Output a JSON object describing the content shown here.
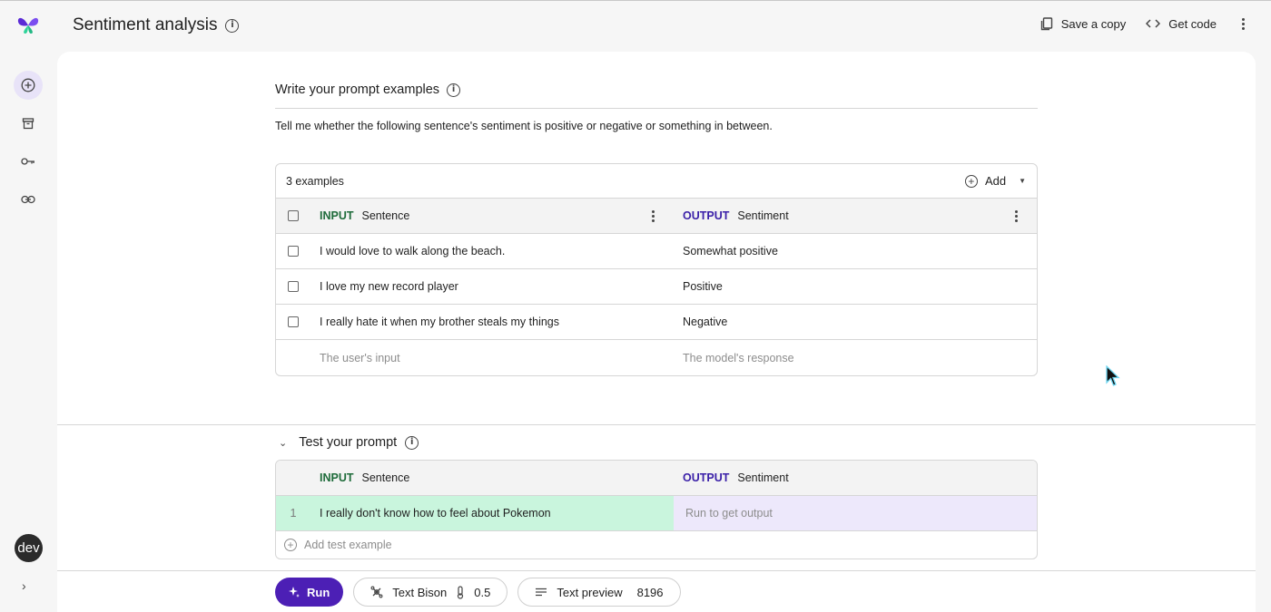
{
  "app": {
    "title": "Sentiment analysis"
  },
  "top_actions": {
    "save_copy": "Save a copy",
    "get_code": "Get code"
  },
  "rail": {
    "avatar_text": "dev"
  },
  "prompt_section": {
    "title": "Write your prompt examples",
    "instruction": "Tell me whether the following sentence's sentiment is positive or negative or something in between."
  },
  "examples": {
    "count_label": "3 examples",
    "add_label": "Add",
    "input_tag": "INPUT",
    "input_col": "Sentence",
    "output_tag": "OUTPUT",
    "output_col": "Sentiment",
    "rows": [
      {
        "input": "I would love to walk along the beach.",
        "output": "Somewhat positive"
      },
      {
        "input": "I love my new record player",
        "output": "Positive"
      },
      {
        "input": "I really hate it when my brother steals my things",
        "output": "Negative"
      }
    ],
    "input_placeholder": "The user's input",
    "output_placeholder": "The model's response"
  },
  "test_section": {
    "title": "Test your prompt",
    "input_tag": "INPUT",
    "input_col": "Sentence",
    "output_tag": "OUTPUT",
    "output_col": "Sentiment",
    "rows": [
      {
        "num": "1",
        "input": "I really don't know how to feel about Pokemon",
        "output": "Run to get output"
      }
    ],
    "add_label": "Add test example"
  },
  "toolbar": {
    "run_label": "Run",
    "model_name": "Text Bison",
    "temperature": "0.5",
    "preview_label": "Text preview",
    "token_limit": "8196"
  },
  "colors": {
    "accent": "#4c1fb5",
    "input_tag": "#1e6b3a",
    "output_tag": "#3a1fa8",
    "input_highlight": "#c9f5dd",
    "output_highlight": "#ede8fb"
  }
}
